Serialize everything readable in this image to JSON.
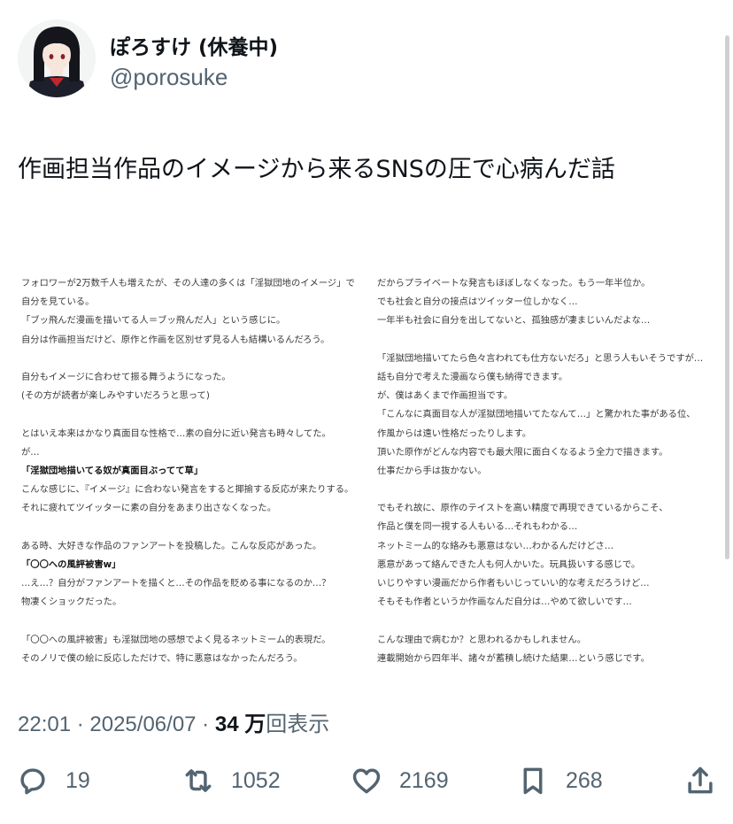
{
  "author": {
    "display_name": "ぽろすけ (休養中)",
    "handle": "@porosuke",
    "avatar_icon": "anime-girl-avatar"
  },
  "tweet": {
    "text": "作画担当作品のイメージから来るSNSの圧で心病んだ話",
    "image_text": {
      "left_column": [
        "フォロワーが2万数千人も増えたが、その人達の多くは「淫獄団地のイメージ」で",
        "自分を見ている。",
        "「ブッ飛んだ漫画を描いてる人＝ブッ飛んだ人」という感じに。",
        "自分は作画担当だけど、原作と作画を区別せず見る人も結構いるんだろう。",
        "",
        "自分もイメージに合わせて振る舞うようになった。",
        "(その方が読者が楽しみやすいだろうと思って)",
        "",
        "とはいえ本来はかなり真面目な性格で…素の自分に近い発言も時々してた。",
        "が…",
        "「淫獄団地描いてる奴が真面目ぶってて草」",
        "こんな感じに、『イメージ』に合わない発言をすると揶揄する反応が来たりする。",
        "それに疲れてツイッターに素の自分をあまり出さなくなった。",
        "",
        "ある時、大好きな作品のファンアートを投稿した。こんな反応があった。",
        "「〇〇への風評被害w」",
        "…え…？自分がファンアートを描くと…その作品を貶める事になるのか…？",
        "物凄くショックだった。",
        "",
        "「〇〇への風評被害」も淫獄団地の感想でよく見るネットミーム的表現だ。",
        "そのノリで僕の絵に反応しただけで、特に悪意はなかったんだろう。"
      ],
      "left_bold_indexes": [
        10,
        15
      ],
      "right_column": [
        "だからプライベートな発言もほぼしなくなった。もう一年半位か。",
        "でも社会と自分の接点はツイッター位しかなく…",
        "一年半も社会に自分を出してないと、孤独感が凄まじいんだよな…",
        "",
        "「淫獄団地描いてたら色々言われても仕方ないだろ」と思う人もいそうですが…",
        "話も自分で考えた漫画なら僕も納得できます。",
        "が、僕はあくまで作画担当です。",
        "「こんなに真面目な人が淫獄団地描いてたなんて…」と驚かれた事がある位、",
        "作風からは遠い性格だったりします。",
        "頂いた原作がどんな内容でも最大限に面白くなるよう全力で描きます。",
        "仕事だから手は抜かない。",
        "",
        "でもそれ故に、原作のテイストを高い精度で再現できているからこそ、",
        "作品と僕を同一視する人もいる…それもわかる…",
        "ネットミーム的な絡みも悪意はない…わかるんだけどさ…",
        "悪意があって絡んできた人も何人かいた。玩具扱いする感じで。",
        "いじりやすい漫画だから作者もいじっていい的な考えだろうけど…",
        "そもそも作者というか作画なんだ自分は…やめて欲しいです…",
        "",
        "こんな理由で病むか？と思われるかもしれません。",
        "連載開始から四年半、諸々が蓄積し続けた結果…という感じです。"
      ]
    },
    "meta": {
      "time": "22:01",
      "separator": " · ",
      "date": "2025/06/07",
      "views_count": "34 万",
      "views_label": "回表示"
    }
  },
  "actions": {
    "reply": {
      "icon": "reply-icon",
      "count": "19"
    },
    "retweet": {
      "icon": "retweet-icon",
      "count": "1052"
    },
    "like": {
      "icon": "heart-icon",
      "count": "2169"
    },
    "bookmark": {
      "icon": "bookmark-icon",
      "count": "268"
    },
    "share": {
      "icon": "share-icon"
    }
  },
  "colors": {
    "text_primary": "#0f1419",
    "text_secondary": "#536471"
  }
}
